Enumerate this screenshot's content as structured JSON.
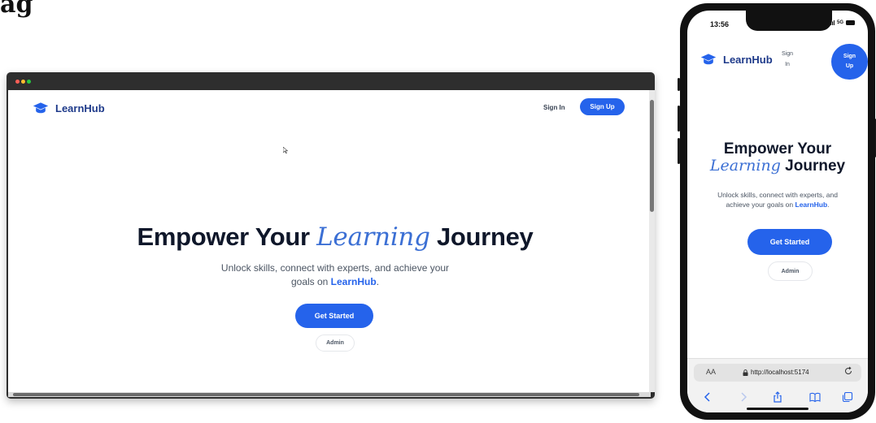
{
  "page": {
    "cut_heading": "ag"
  },
  "desktop": {
    "brand": "LearnHub",
    "nav": {
      "sign_in": "Sign In",
      "sign_up": "Sign Up"
    },
    "hero": {
      "title_part1": "Empower Your ",
      "title_accent": "Learning",
      "title_part2": " Journey",
      "subtitle_line1": "Unlock skills, connect with experts, and achieve your",
      "subtitle_line2_prefix": "goals on ",
      "subtitle_brand": "LearnHub",
      "subtitle_suffix": ".",
      "primary_cta": "Get Started",
      "secondary_cta": "Admin"
    }
  },
  "mobile": {
    "status": {
      "time": "13:56",
      "network": "5G"
    },
    "brand": "LearnHub",
    "nav": {
      "sign_in_line1": "Sign",
      "sign_in_line2": "In",
      "sign_up_line1": "Sign",
      "sign_up_line2": "Up"
    },
    "hero": {
      "title_line1": "Empower Your",
      "title_accent": "Learning",
      "title_line2_rest": " Journey",
      "subtitle_line1": "Unlock skills, connect with experts, and",
      "subtitle_line2_prefix": "achieve your goals on ",
      "subtitle_brand": "LearnHub",
      "subtitle_suffix": ".",
      "primary_cta": "Get Started",
      "secondary_cta": "Admin"
    },
    "browser": {
      "text_size": "AA",
      "url": "http://localhost:5174"
    }
  },
  "colors": {
    "primary": "#2563eb",
    "brand_text": "#1e3a8a",
    "accent": "#3b6fd4",
    "heading": "#0f172a"
  }
}
